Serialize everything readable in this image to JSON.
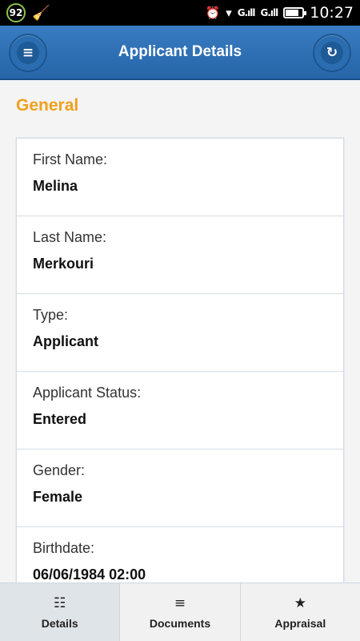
{
  "status_bar": {
    "badge": "92",
    "time": "10:27",
    "signal_1": "G.ıll",
    "signal_2": "G.ıll",
    "icons": [
      "alarm-icon",
      "wifi-icon",
      "battery-icon",
      "cleaner-icon"
    ]
  },
  "header": {
    "title": "Applicant Details",
    "left_icon": "menu-icon",
    "right_icon": "refresh-icon"
  },
  "section": {
    "title": "General"
  },
  "fields": [
    {
      "label": "First Name:",
      "value": "Melina"
    },
    {
      "label": "Last Name:",
      "value": "Merkouri"
    },
    {
      "label": "Type:",
      "value": "Applicant"
    },
    {
      "label": "Applicant Status:",
      "value": "Entered"
    },
    {
      "label": "Gender:",
      "value": "Female"
    },
    {
      "label": "Birthdate:",
      "value": "06/06/1984 02:00"
    }
  ],
  "bottom_nav": [
    {
      "label": "Details",
      "icon": "grid-icon",
      "active": true
    },
    {
      "label": "Documents",
      "icon": "list-icon",
      "active": false
    },
    {
      "label": "Appraisal",
      "icon": "star-icon",
      "active": false
    }
  ],
  "colors": {
    "header": "#2b6cb0",
    "section_title": "#f0a01e",
    "active_tab": "#dfe4e9"
  }
}
